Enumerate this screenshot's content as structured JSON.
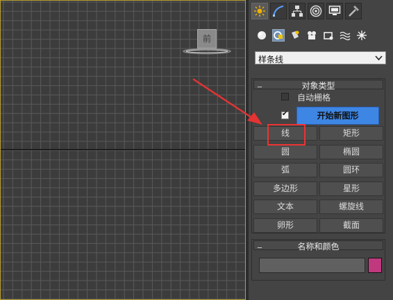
{
  "viewport": {
    "viewcube_label": "前",
    "colors": {
      "background": "#3c3c3c",
      "grid": "#5a5a5a",
      "border": "#b8a030"
    }
  },
  "tabs": [
    {
      "name": "create-tab",
      "icon": "sun-star-icon",
      "active": true
    },
    {
      "name": "modify-tab",
      "icon": "curve-icon",
      "active": false
    },
    {
      "name": "hierarchy-tab",
      "icon": "hierarchy-icon",
      "active": false
    },
    {
      "name": "motion-tab",
      "icon": "motion-circle-icon",
      "active": false
    },
    {
      "name": "display-tab",
      "icon": "monitor-icon",
      "active": false
    },
    {
      "name": "utilities-tab",
      "icon": "hammer-icon",
      "active": false
    }
  ],
  "category_icons": [
    "geometry-sphere-icon",
    "shapes-icon",
    "lights-icon",
    "cameras-icon",
    "helpers-icon",
    "spacewarps-icon",
    "systems-icon"
  ],
  "dropdown": {
    "value": "样条线"
  },
  "object_type": {
    "title": "对象类型",
    "autogrid_label": "自动栅格",
    "autogrid_checked": false,
    "start_shape_checked": true,
    "start_shape_label": "开始新图形",
    "buttons": [
      "线",
      "矩形",
      "圆",
      "椭圆",
      "弧",
      "圆环",
      "多边形",
      "星形",
      "文本",
      "螺旋线",
      "卵形",
      "截面"
    ]
  },
  "name_color": {
    "title": "名称和颜色",
    "name_value": "",
    "swatch_color": "#c0397f"
  },
  "accent": {
    "primary_button": "#3e86e4",
    "highlight": "#e33333"
  }
}
